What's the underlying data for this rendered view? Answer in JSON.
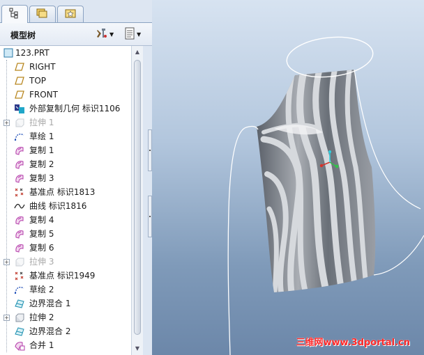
{
  "tabs": [
    {
      "name": "model-tree-tab",
      "icon": "model-tree-icon"
    },
    {
      "name": "folder-browser-tab",
      "icon": "folders-icon"
    },
    {
      "name": "favorites-tab",
      "icon": "star-folder-icon"
    }
  ],
  "panel": {
    "title": "模型树",
    "settings_icon": "tools-icon",
    "show_icon": "list-settings-icon"
  },
  "tree": {
    "items": [
      {
        "label": "123.PRT",
        "icon": "part-icon",
        "type": "root"
      },
      {
        "label": "RIGHT",
        "icon": "datum-plane-icon"
      },
      {
        "label": "TOP",
        "icon": "datum-plane-icon"
      },
      {
        "label": "FRONT",
        "icon": "datum-plane-icon"
      },
      {
        "label": "外部复制几何 标识1106",
        "icon": "external-copy-geom-icon"
      },
      {
        "label": "拉伸 1",
        "icon": "extrude-icon",
        "expandable": true,
        "suppressed": true
      },
      {
        "label": "草绘 1",
        "icon": "sketch-icon"
      },
      {
        "label": "复制 1",
        "icon": "copy-surface-icon"
      },
      {
        "label": "复制 2",
        "icon": "copy-surface-icon"
      },
      {
        "label": "复制 3",
        "icon": "copy-surface-icon"
      },
      {
        "label": "基准点 标识1813",
        "icon": "datum-point-icon"
      },
      {
        "label": "曲线 标识1816",
        "icon": "curve-icon"
      },
      {
        "label": "复制 4",
        "icon": "copy-surface-icon"
      },
      {
        "label": "复制 5",
        "icon": "copy-surface-icon"
      },
      {
        "label": "复制 6",
        "icon": "copy-surface-icon"
      },
      {
        "label": "拉伸 3",
        "icon": "extrude-icon",
        "expandable": true,
        "suppressed": true
      },
      {
        "label": "基准点 标识1949",
        "icon": "datum-point-icon"
      },
      {
        "label": "草绘 2",
        "icon": "sketch-icon"
      },
      {
        "label": "边界混合 1",
        "icon": "boundary-blend-icon"
      },
      {
        "label": "拉伸 2",
        "icon": "extrude-icon",
        "expandable": true
      },
      {
        "label": "边界混合 2",
        "icon": "boundary-blend-icon"
      },
      {
        "label": "合并 1",
        "icon": "merge-icon"
      }
    ]
  },
  "viewport": {
    "watermark": "三维网www.3dportal.cn"
  },
  "colors": {
    "panel_bg": "#dde6f2",
    "viewport_top": "#d7e3f1",
    "viewport_bottom": "#6c87a9",
    "watermark": "#ff2a2a",
    "plane_icon": "#b8861f",
    "sketch_icon": "#1f4fb8",
    "copy_icon": "#b23aa8",
    "point_icon": "#c0392b"
  }
}
